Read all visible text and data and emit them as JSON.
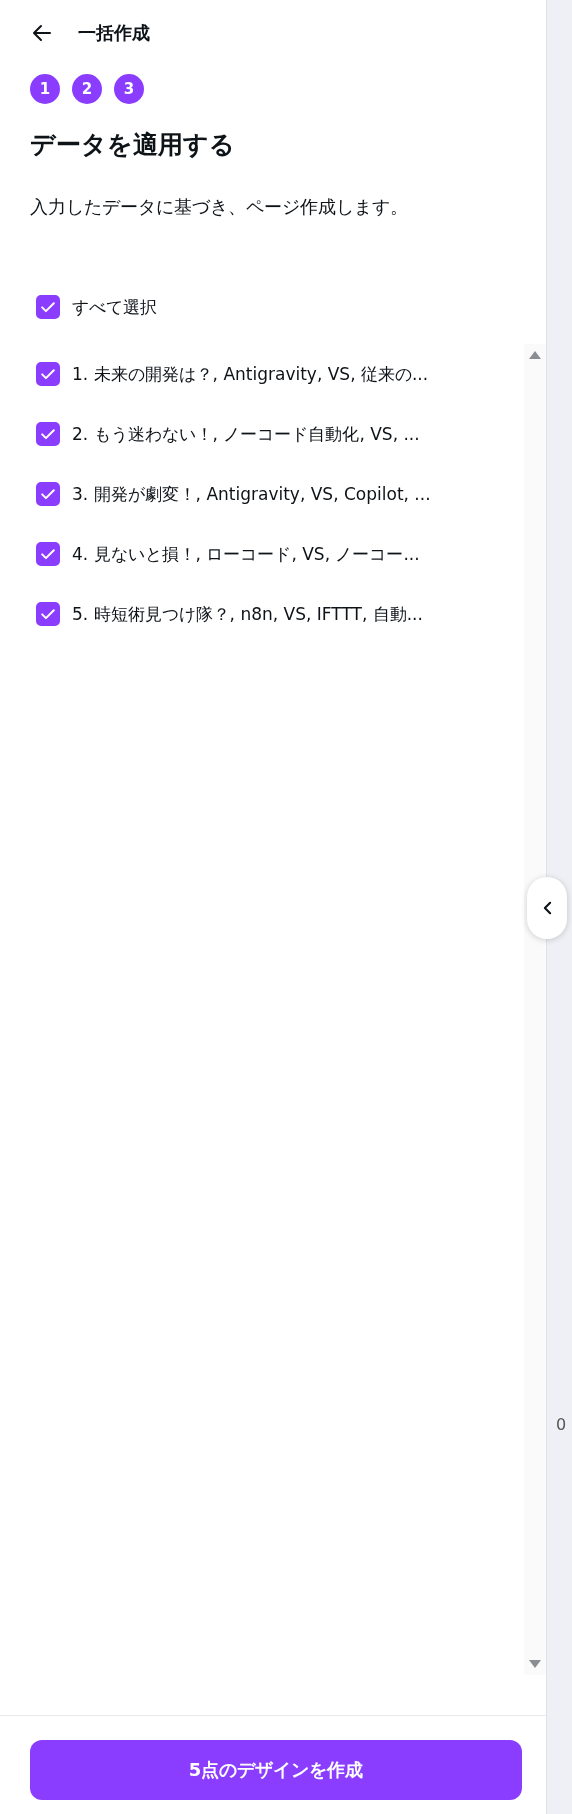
{
  "header": {
    "title": "一括作成"
  },
  "steps": [
    {
      "label": "1"
    },
    {
      "label": "2"
    },
    {
      "label": "3"
    }
  ],
  "heading": "データを適用する",
  "description": "入力したデータに基づき、ページ作成します。",
  "select_all": {
    "label": "すべて選択",
    "checked": true
  },
  "rows": [
    {
      "label": "1. 未来の開発は？, Antigravity, VS, 従来の...",
      "checked": true
    },
    {
      "label": "2. もう迷わない！, ノーコード自動化, VS, ...",
      "checked": true
    },
    {
      "label": "3. 開発が劇変！, Antigravity, VS, Copilot, ...",
      "checked": true
    },
    {
      "label": "4. 見ないと損！, ローコード, VS, ノーコー...",
      "checked": true
    },
    {
      "label": "5. 時短術見つけ隊？, n8n, VS, IFTTT, 自動...",
      "checked": true
    }
  ],
  "side_text": "0",
  "create_button": "5点のデザインを作成"
}
